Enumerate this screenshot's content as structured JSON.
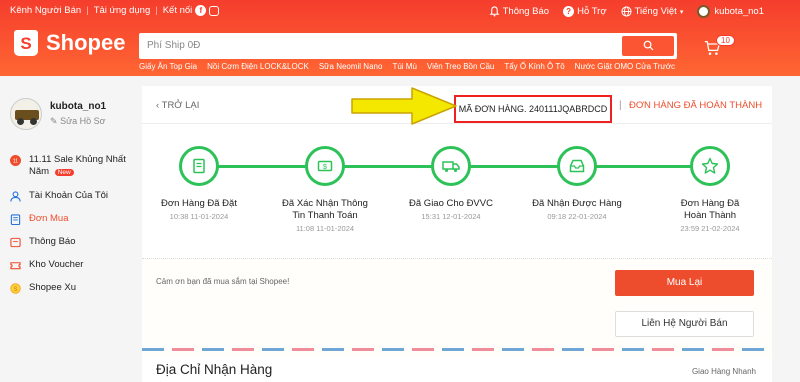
{
  "topnav": {
    "seller": "Kênh Người Bán",
    "app": "Tải ứng dụng",
    "connect": "Kết nối",
    "notifications": "Thông Báo",
    "notif_count": "5",
    "help": "Hỗ Trợ",
    "language": "Tiếng Việt",
    "username": "kubota_no1"
  },
  "header": {
    "logo": "Shopee",
    "search_placeholder": "Phí Ship 0Đ",
    "cart_count": "10",
    "suggestions": [
      "Giấy Ăn Top Gia",
      "Nồi Cơm Điện LOCK&LOCK",
      "Sữa Neomil Nano",
      "Túi Mù",
      "Viên Treo Bồn Cầu",
      "Tẩy Ố Kính Ô Tô",
      "Nước Giặt OMO Cửa Trước"
    ]
  },
  "sidebar": {
    "username": "kubota_no1",
    "edit": "Sửa Hồ Sơ",
    "items": [
      {
        "label": "11.11 Sale Khủng Nhất Năm",
        "badge": "New",
        "icon": "sale-icon"
      },
      {
        "label": "Tài Khoản Của Tôi",
        "icon": "user-icon"
      },
      {
        "label": "Đơn Mua",
        "icon": "order-icon",
        "active": true
      },
      {
        "label": "Thông Báo",
        "icon": "bell-icon"
      },
      {
        "label": "Kho Voucher",
        "icon": "voucher-icon"
      },
      {
        "label": "Shopee Xu",
        "icon": "coin-icon"
      }
    ]
  },
  "order": {
    "back": "TRỞ LẠI",
    "order_no": "MÃ ĐƠN HÀNG. 240111JQABRDCD",
    "separator": "|",
    "status": "ĐƠN HÀNG ĐÃ HOÀN THÀNH",
    "steps": [
      {
        "label": "Đơn Hàng Đã Đặt",
        "time": "10:38 11-01-2024",
        "icon": "receipt-icon"
      },
      {
        "label": "Đã Xác Nhận Thông Tin Thanh Toán",
        "time": "11:08 11-01-2024",
        "icon": "money-icon"
      },
      {
        "label": "Đã Giao Cho ĐVVC",
        "time": "15:31 12-01-2024",
        "icon": "truck-icon"
      },
      {
        "label": "Đã Nhận Được Hàng",
        "time": "09:18 22-01-2024",
        "icon": "inbox-icon"
      },
      {
        "label": "Đơn Hàng Đã Hoàn Thành",
        "time": "23:59 21-02-2024",
        "icon": "star-icon"
      }
    ],
    "thanks": "Cảm ơn bạn đã mua sắm tại Shopee!",
    "buy_again": "Mua Lại",
    "contact_seller": "Liên Hệ Người Bán",
    "address_title": "Địa Chỉ Nhận Hàng",
    "shipper": "Giao Hàng Nhanh"
  },
  "colors": {
    "brand": "#ee4d2d",
    "success": "#2dc258",
    "highlight": "#e22222",
    "arrow": "#f5e800"
  }
}
